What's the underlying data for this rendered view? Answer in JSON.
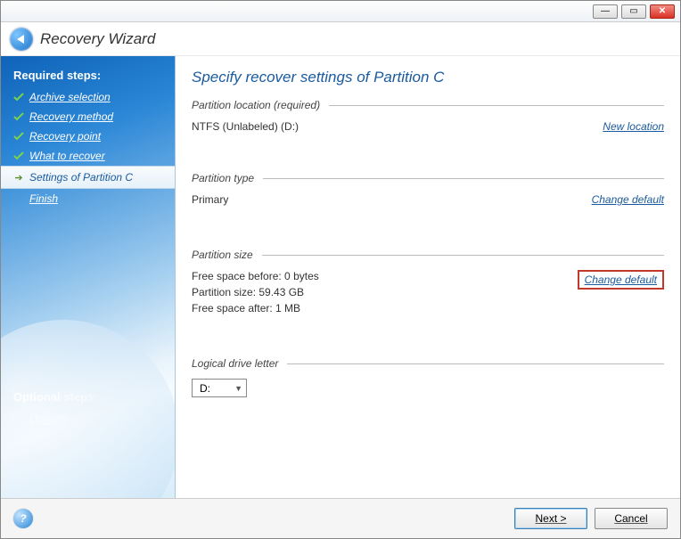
{
  "header": {
    "title": "Recovery Wizard"
  },
  "sidebar": {
    "required_heading": "Required steps:",
    "items": [
      {
        "label": "Archive selection"
      },
      {
        "label": "Recovery method"
      },
      {
        "label": "Recovery point"
      },
      {
        "label": "What to recover"
      },
      {
        "label": "Settings of Partition C"
      },
      {
        "label": "Finish"
      }
    ],
    "optional_heading": "Optional steps:",
    "options_label": "Options"
  },
  "main": {
    "title": "Specify recover settings of Partition C",
    "location": {
      "heading": "Partition location (required)",
      "value": "NTFS (Unlabeled) (D:)",
      "link": "New location"
    },
    "type": {
      "heading": "Partition type",
      "value": "Primary",
      "link": "Change default"
    },
    "size": {
      "heading": "Partition size",
      "before": "Free space before: 0 bytes",
      "psize": "Partition size: 59.43 GB",
      "after": "Free space after: 1 MB",
      "link": "Change default"
    },
    "drive": {
      "heading": "Logical drive letter",
      "value": "D:"
    }
  },
  "footer": {
    "next": "Next >",
    "cancel": "Cancel"
  }
}
